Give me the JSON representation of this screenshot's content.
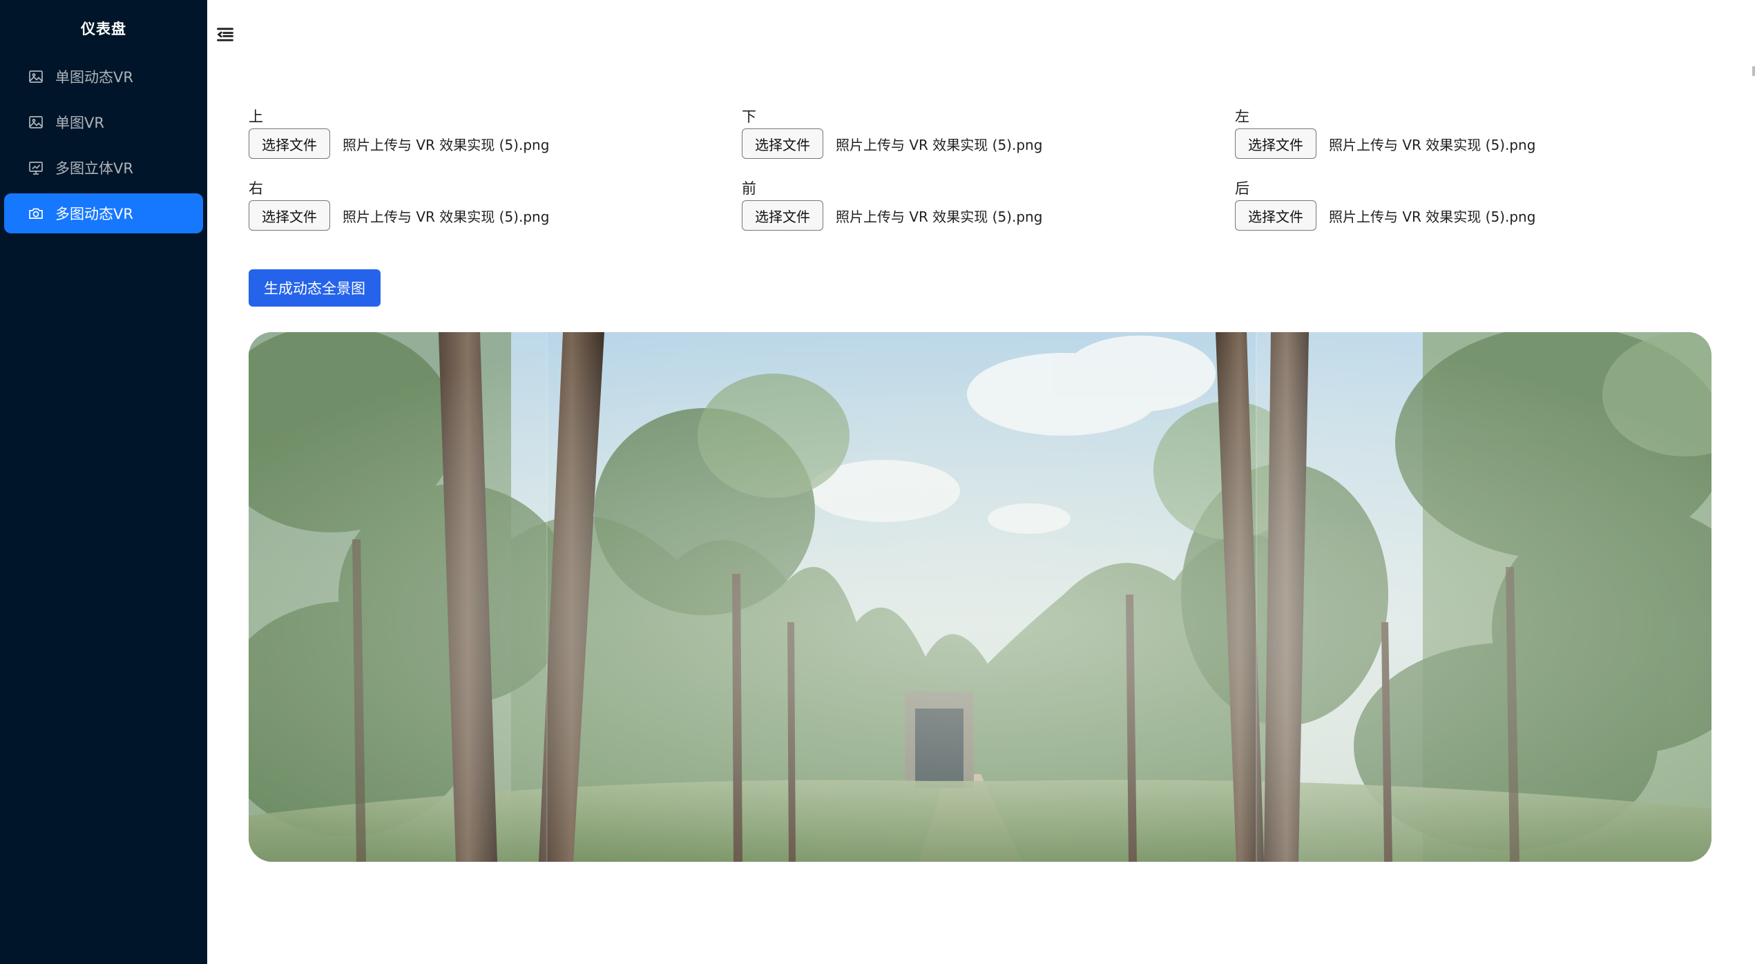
{
  "sidebar": {
    "title": "仪表盘",
    "items": [
      {
        "label": "单图动态VR",
        "icon": "image-icon",
        "active": false
      },
      {
        "label": "单图VR",
        "icon": "image-icon",
        "active": false
      },
      {
        "label": "多图立体VR",
        "icon": "chart-board-icon",
        "active": false
      },
      {
        "label": "多图动态VR",
        "icon": "camera-icon",
        "active": true
      }
    ]
  },
  "header": {
    "toggle_icon": "menu-fold-icon"
  },
  "uploads": [
    {
      "label": "上",
      "button": "选择文件",
      "file": "照片上传与 VR 效果实现 (5).png"
    },
    {
      "label": "下",
      "button": "选择文件",
      "file": "照片上传与 VR 效果实现 (5).png"
    },
    {
      "label": "左",
      "button": "选择文件",
      "file": "照片上传与 VR 效果实现 (5).png"
    },
    {
      "label": "右",
      "button": "选择文件",
      "file": "照片上传与 VR 效果实现 (5).png"
    },
    {
      "label": "前",
      "button": "选择文件",
      "file": "照片上传与 VR 效果实现 (5).png"
    },
    {
      "label": "后",
      "button": "选择文件",
      "file": "照片上传与 VR 效果实现 (5).png"
    }
  ],
  "generate_button": "生成动态全景图",
  "colors": {
    "sidebar_bg": "#001529",
    "active_menu": "#1677ff",
    "primary_button": "#2563eb"
  }
}
